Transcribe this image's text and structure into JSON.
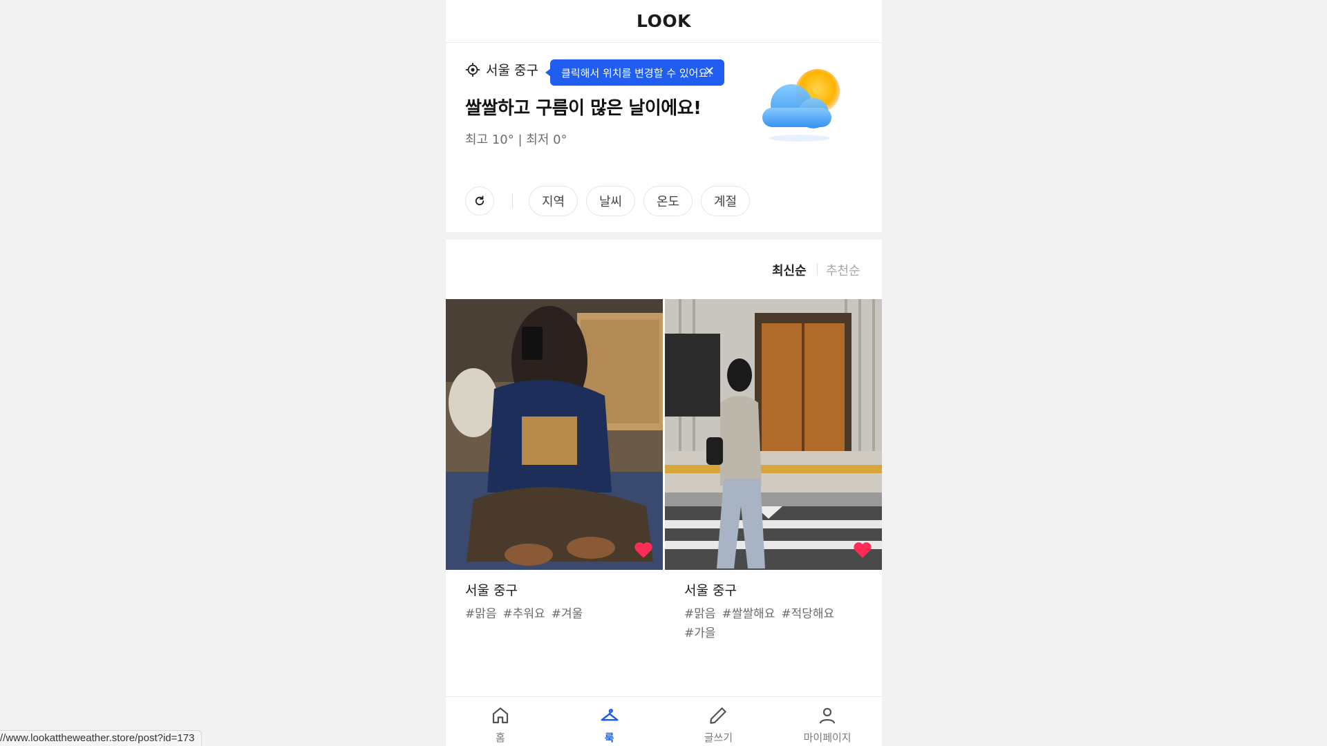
{
  "app": {
    "title": "LOOK"
  },
  "weather": {
    "location": "서울 중구",
    "tooltip": "클릭해서 위치를 변경할 수 있어요!",
    "headline": "쌀쌀하고 구름이 많은 날이에요!",
    "high_low": "최고 10° | 최저 0°",
    "icon": "cloud-sun-icon"
  },
  "filters": {
    "refresh_icon": "refresh-icon",
    "chips": [
      "지역",
      "날씨",
      "온도",
      "계절"
    ]
  },
  "sort": {
    "latest": "최신순",
    "recommended": "추천순"
  },
  "posts": [
    {
      "location": "서울 중구",
      "tags": [
        "#맑음",
        "#추워요",
        "#겨울"
      ],
      "liked": true
    },
    {
      "location": "서울 중구",
      "tags": [
        "#맑음",
        "#쌀쌀해요",
        "#적당해요",
        "#가을"
      ],
      "liked": true
    }
  ],
  "bottom_nav": {
    "items": [
      {
        "label": "홈",
        "icon": "home-icon"
      },
      {
        "label": "룩",
        "icon": "hanger-icon",
        "active": true
      },
      {
        "label": "글쓰기",
        "icon": "pencil-icon"
      },
      {
        "label": "마이페이지",
        "icon": "user-icon"
      }
    ]
  },
  "status_bar": {
    "url": "//www.lookattheweather.store/post?id=173"
  },
  "colors": {
    "accent": "#1f5ef0",
    "heart": "#ff2d55"
  }
}
